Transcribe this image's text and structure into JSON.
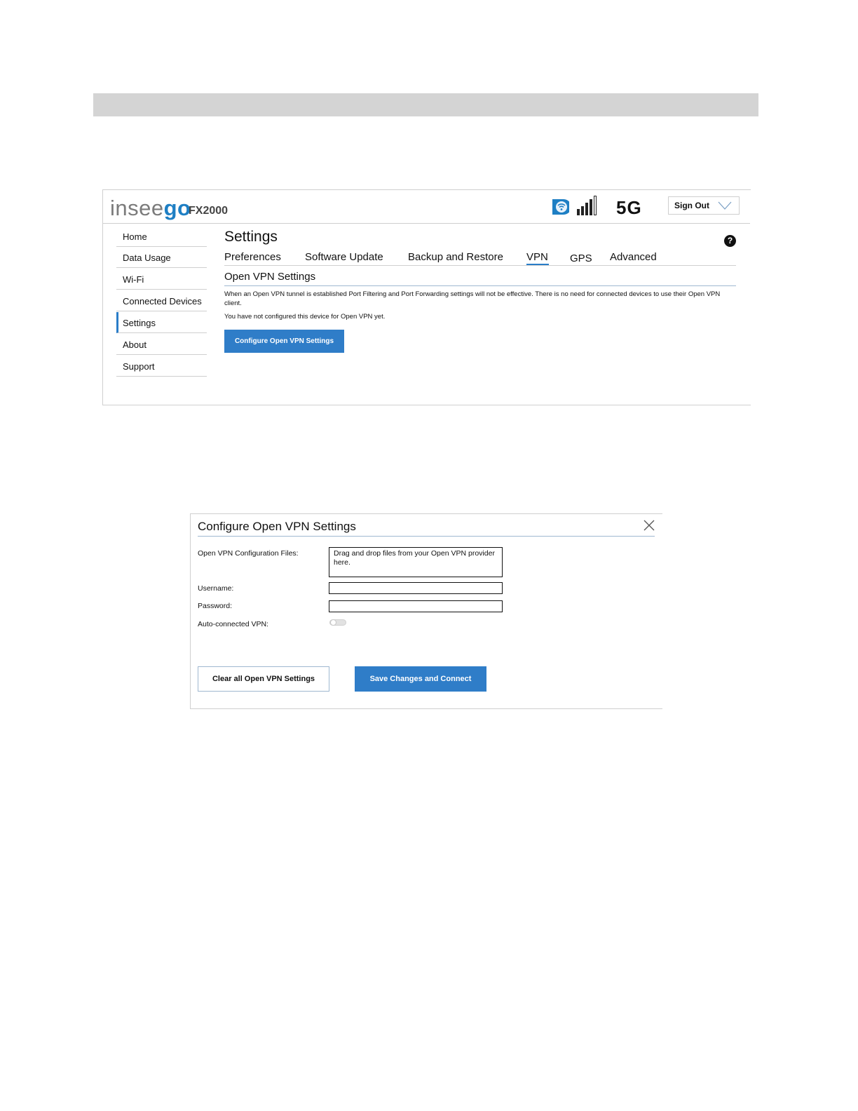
{
  "app": {
    "logo_text_part1": "insee",
    "logo_text_part2": "go",
    "model": "FX2000",
    "network_type": "5G",
    "sign_out_label": "Sign Out",
    "colors": {
      "brand": "#1e7fc4",
      "accent": "#2f7dc8"
    }
  },
  "sidebar": {
    "items": [
      {
        "label": "Home"
      },
      {
        "label": "Data Usage"
      },
      {
        "label": "Wi-Fi"
      },
      {
        "label": "Connected Devices"
      },
      {
        "label": "Settings",
        "active": true
      },
      {
        "label": "About"
      },
      {
        "label": "Support"
      }
    ]
  },
  "main": {
    "title": "Settings",
    "help_glyph": "?",
    "tabs": [
      {
        "label": "Preferences"
      },
      {
        "label": "Software Update"
      },
      {
        "label": "Backup and Restore"
      },
      {
        "label": "VPN",
        "active": true
      },
      {
        "label": "GPS"
      },
      {
        "label": "Advanced"
      }
    ],
    "section_title": "Open VPN Settings",
    "notice": "When an Open VPN tunnel is established  Port Filtering and Port Forwarding settings will not be effective. There is  no need for connected devices to use their Open VPN client.",
    "status": "You have not configured this device for Open VPN yet.",
    "configure_button": "Configure Open VPN Settings"
  },
  "dialog": {
    "title": "Configure Open VPN Settings",
    "files_label": "Open VPN Configuration Files:",
    "dropzone_text": "Drag and drop files from your Open VPN provider here.",
    "username_label": "Username:",
    "username_value": "",
    "password_label": "Password:",
    "password_value": "",
    "auto_vpn_label": "Auto-connected VPN:",
    "auto_vpn_enabled": false,
    "clear_button": "Clear all Open VPN Settings",
    "save_button": "Save Changes and Connect"
  }
}
